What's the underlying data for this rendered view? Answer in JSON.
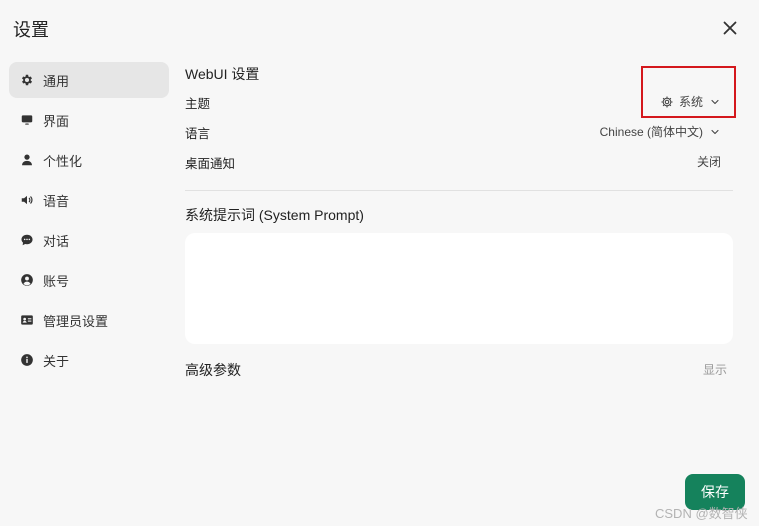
{
  "dialog": {
    "title": "设置"
  },
  "sidebar": {
    "items": [
      {
        "label": "通用",
        "icon": "gear-icon"
      },
      {
        "label": "界面",
        "icon": "monitor-icon"
      },
      {
        "label": "个性化",
        "icon": "user-icon"
      },
      {
        "label": "语音",
        "icon": "speaker-icon"
      },
      {
        "label": "对话",
        "icon": "chat-icon"
      },
      {
        "label": "账号",
        "icon": "account-icon"
      },
      {
        "label": "管理员设置",
        "icon": "id-card-icon"
      },
      {
        "label": "关于",
        "icon": "info-icon"
      }
    ]
  },
  "general": {
    "section_title": "WebUI 设置",
    "theme_label": "主题",
    "theme_value": "系统",
    "language_label": "语言",
    "language_value": "Chinese (简体中文)",
    "notification_label": "桌面通知",
    "notification_value": "关闭",
    "system_prompt_label": "系统提示词 (System Prompt)",
    "system_prompt_value": "",
    "advanced_label": "高级参数",
    "advanced_toggle": "显示"
  },
  "footer": {
    "save_label": "保存"
  },
  "watermark": "CSDN @数智侠",
  "colors": {
    "accent": "#15825c",
    "highlight": "#d4181d"
  }
}
